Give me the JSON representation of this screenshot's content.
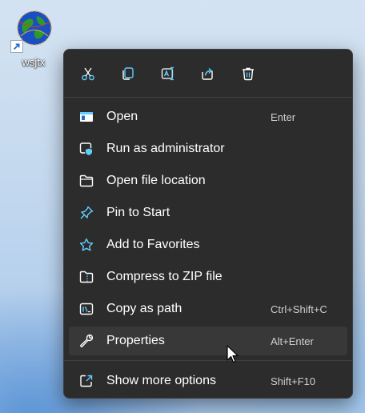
{
  "desktop": {
    "shortcut": {
      "label": "wsjtx",
      "icon": "globe-icon"
    }
  },
  "context_menu": {
    "toolbar": [
      {
        "name": "cut",
        "icon": "scissors-icon"
      },
      {
        "name": "copy",
        "icon": "copy-icon"
      },
      {
        "name": "rename",
        "icon": "rename-icon"
      },
      {
        "name": "share",
        "icon": "share-icon"
      },
      {
        "name": "delete",
        "icon": "trash-icon"
      }
    ],
    "items": [
      {
        "label": "Open",
        "shortcut": "Enter",
        "icon": "open-app-icon"
      },
      {
        "label": "Run as administrator",
        "shortcut": "",
        "icon": "shield-icon"
      },
      {
        "label": "Open file location",
        "shortcut": "",
        "icon": "folder-icon"
      },
      {
        "label": "Pin to Start",
        "shortcut": "",
        "icon": "pin-icon"
      },
      {
        "label": "Add to Favorites",
        "shortcut": "",
        "icon": "star-icon"
      },
      {
        "label": "Compress to ZIP file",
        "shortcut": "",
        "icon": "zip-folder-icon"
      },
      {
        "label": "Copy as path",
        "shortcut": "Ctrl+Shift+C",
        "icon": "copy-path-icon"
      },
      {
        "label": "Properties",
        "shortcut": "Alt+Enter",
        "icon": "wrench-icon"
      },
      {
        "label": "Show more options",
        "shortcut": "Shift+F10",
        "icon": "more-options-icon"
      }
    ],
    "colors": {
      "background": "#2c2c2c",
      "hover": "#383838",
      "icon_accent": "#60cdff",
      "text": "#ffffff"
    }
  }
}
